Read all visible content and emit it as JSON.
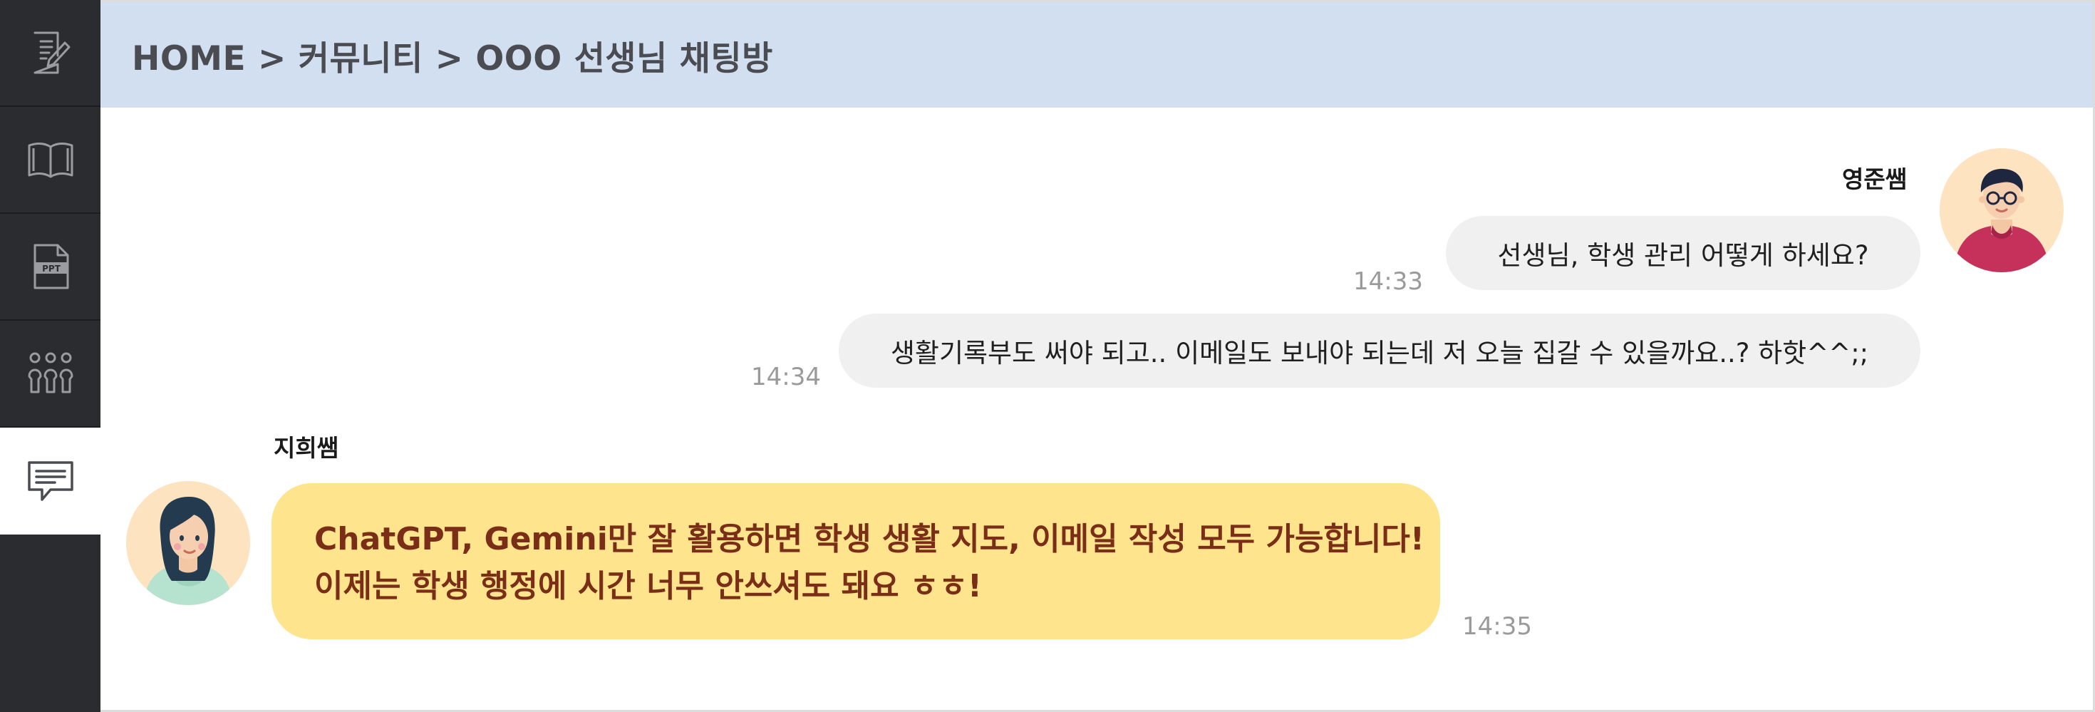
{
  "sidebar": {
    "items": [
      {
        "name": "notes-icon"
      },
      {
        "name": "book-icon"
      },
      {
        "name": "ppt-icon",
        "label": "PPT"
      },
      {
        "name": "community-icon"
      },
      {
        "name": "chat-icon",
        "active": true
      }
    ]
  },
  "header": {
    "breadcrumb": "HOME  >  커뮤니티 > OOO 선생님 채팅방"
  },
  "chat": {
    "messages": [
      {
        "sender": "영준쌤",
        "text": "선생님, 학생 관리 어떻게 하세요?",
        "time": "14:33",
        "side": "right"
      },
      {
        "sender": "영준쌤",
        "text": "생활기록부도 써야 되고.. 이메일도 보내야 되는데 저 오늘 집갈 수 있을까요..? 하핫^^;;",
        "time": "14:34",
        "side": "right"
      },
      {
        "sender": "지희쌤",
        "lines": [
          "ChatGPT, Gemini만 잘 활용하면 학생 생활 지도, 이메일 작성 모두 가능합니다!",
          "이제는 학생 행정에 시간 너무 안쓰셔도 돼요 ㅎㅎ!"
        ],
        "time": "14:35",
        "side": "left"
      }
    ]
  },
  "colors": {
    "sidebar_bg": "#2a2c30",
    "header_bg": "#d2dff1",
    "bubble_bg": "#f0f0f0",
    "highlight_bg": "#ffe48e",
    "highlight_text": "#7a2e17"
  }
}
